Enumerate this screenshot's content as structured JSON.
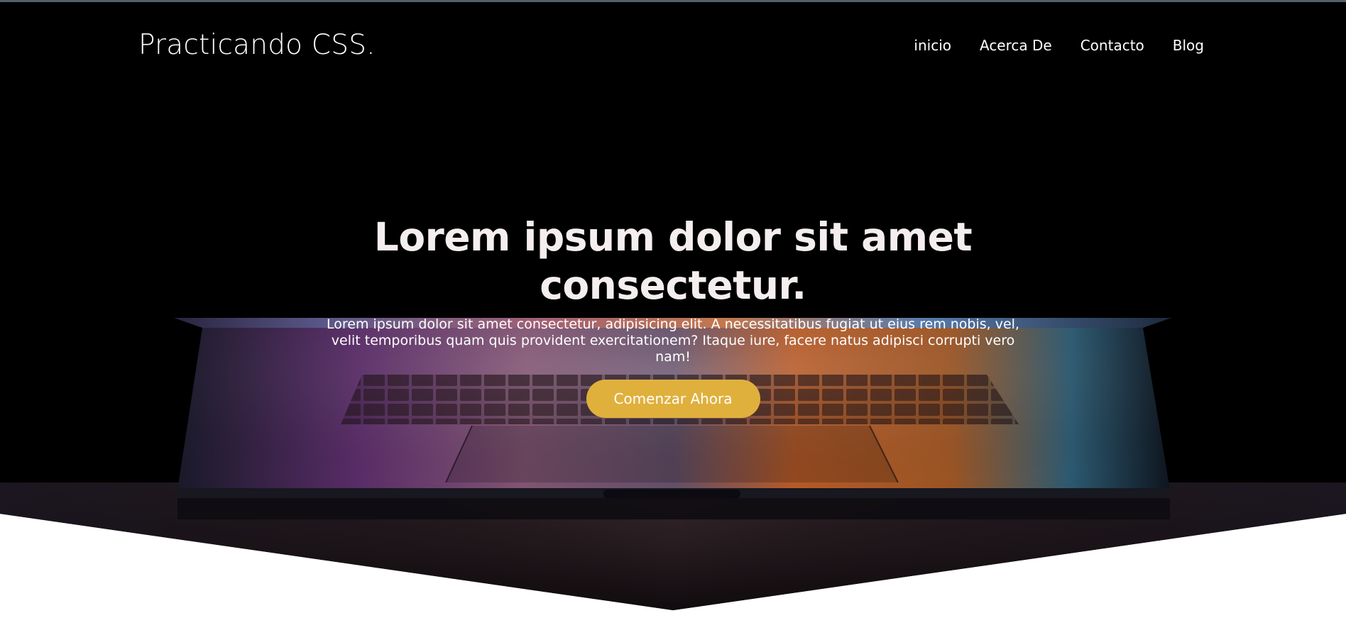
{
  "brand": "Practicando CSS.",
  "nav": {
    "items": [
      "inicio",
      "Acerca De",
      "Contacto",
      "Blog"
    ]
  },
  "hero": {
    "title": "Lorem ipsum dolor sit amet consectetur.",
    "text": "Lorem ipsum dolor sit amet consectetur, adipisicing elit. A necessitatibus fugiat ut eius rem nobis, vel, velit temporibus quam quis provident exercitationem? Itaque iure, facere natus adipisci corrupti vero nam!",
    "button_label": "Comenzar Ahora"
  },
  "colors": {
    "accent": "#e0b03d",
    "background": "#000000",
    "title": "#f5eeee"
  }
}
